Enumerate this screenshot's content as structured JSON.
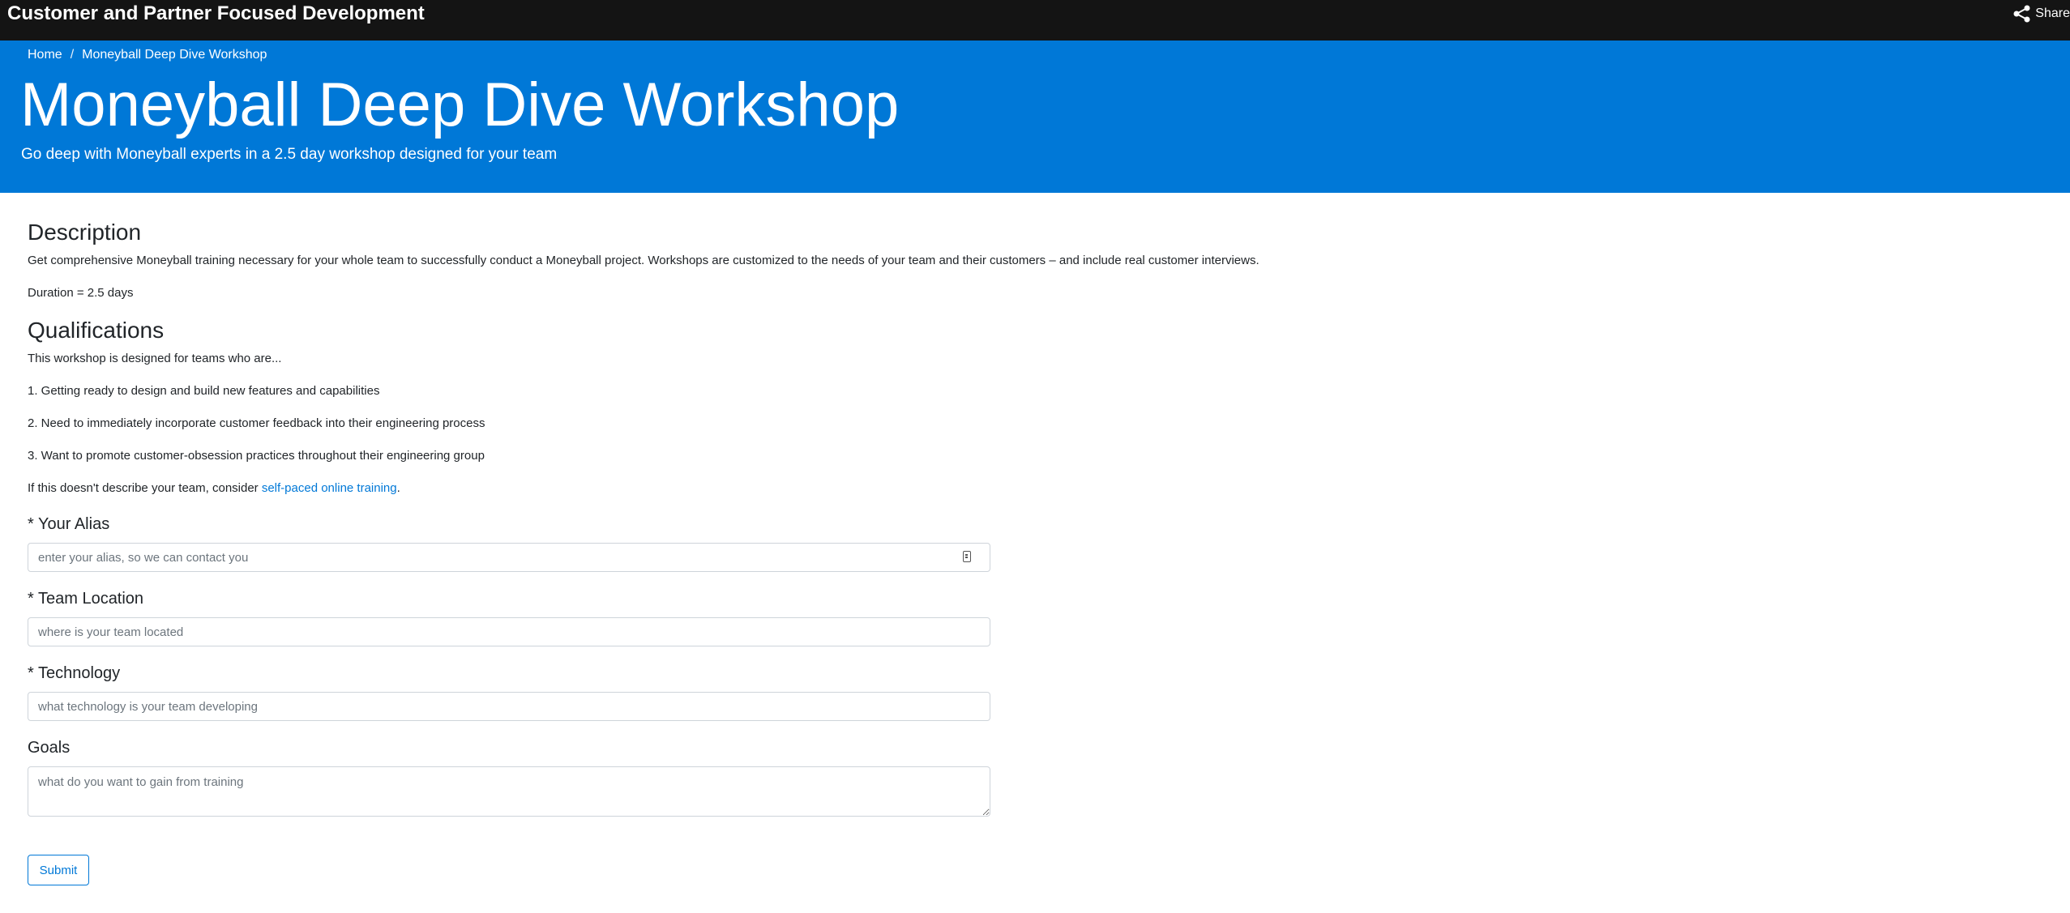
{
  "topbar": {
    "title": "Customer and Partner Focused Development",
    "share_label": "Share",
    "share_icon": "share-icon"
  },
  "breadcrumb": {
    "home": "Home",
    "separator": "/",
    "current": "Moneyball Deep Dive Workshop"
  },
  "hero": {
    "title": "Moneyball Deep Dive Workshop",
    "subtitle": "Go deep with Moneyball experts in a 2.5 day workshop designed for your team",
    "background_color": "#0078d7"
  },
  "description": {
    "heading": "Description",
    "text": "Get comprehensive Moneyball training necessary for your whole team to successfully conduct a Moneyball project. Workshops are customized to the needs of your team and their customers – and include real customer interviews.",
    "duration": "Duration = 2.5 days"
  },
  "qualifications": {
    "heading": "Qualifications",
    "intro": "This workshop is designed for teams who are...",
    "items": [
      "1. Getting ready to design and build new features and capabilities",
      "2. Need to immediately incorporate customer feedback into their engineering process",
      "3. Want to promote customer-obsession practices throughout their engineering group"
    ],
    "alt_prefix": "If this doesn't describe your team, consider ",
    "alt_link": "self-paced online training",
    "alt_suffix": "."
  },
  "form": {
    "alias": {
      "label": "* Your Alias",
      "placeholder": "enter your alias, so we can contact you",
      "value": ""
    },
    "location": {
      "label": "* Team Location",
      "placeholder": "where is your team located",
      "value": ""
    },
    "technology": {
      "label": "* Technology",
      "placeholder": "what technology is your team developing",
      "value": ""
    },
    "goals": {
      "label": "Goals",
      "placeholder": "what do you want to gain from training",
      "value": ""
    },
    "submit_label": "Submit"
  },
  "colors": {
    "topbar": "#141414",
    "accent": "#0078d7"
  }
}
